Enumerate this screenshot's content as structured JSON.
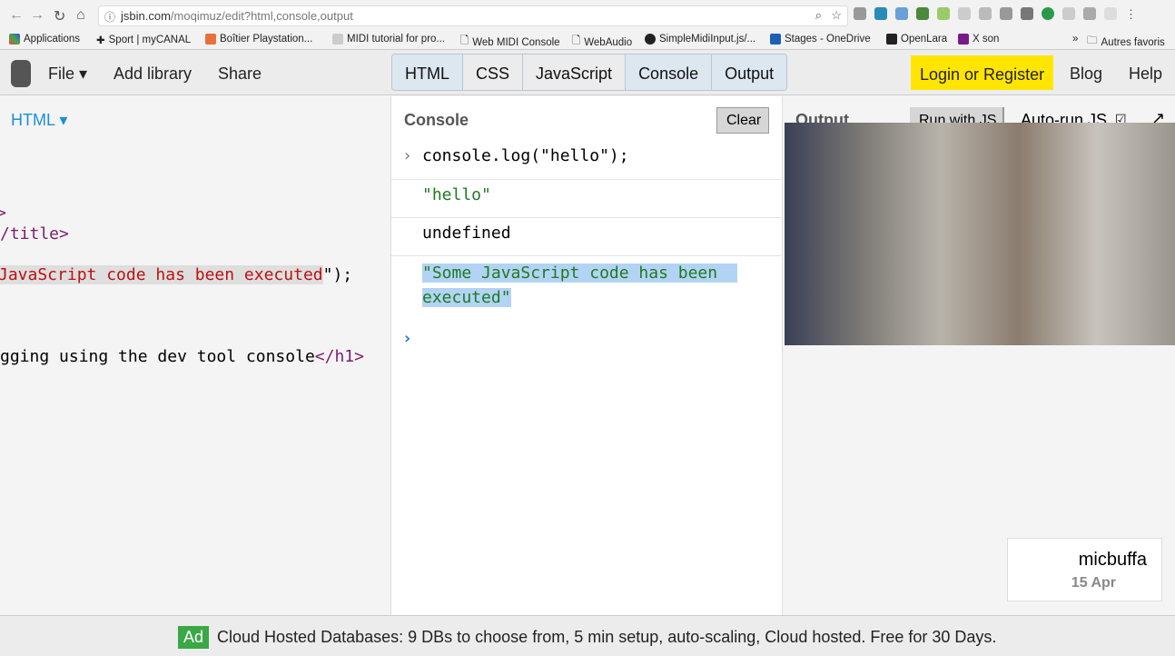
{
  "browser": {
    "url_domain": "jsbin.com",
    "url_path": "/moqimuz/edit?html,console,output",
    "bookmarks": [
      "Applications",
      "Sport | myCANAL",
      "Boîtier Playstation...",
      "MIDI tutorial for pro...",
      "Web MIDI Console",
      "WebAudio",
      "SimpleMidiInput.js/...",
      "Stages - OneDrive",
      "OpenLara",
      "X son"
    ],
    "other_bookmarks": "Autres favoris",
    "overflow": "»"
  },
  "header": {
    "file": "File ▾",
    "add_library": "Add library",
    "share": "Share",
    "tabs": [
      "HTML",
      "CSS",
      "JavaScript",
      "Console",
      "Output"
    ],
    "login": "Login or Register",
    "blog": "Blog",
    "help": "Help"
  },
  "html_panel": {
    "title": "HTML ▾",
    "lines": [
      ">",
      "/title>",
      "JavaScript code has been executed",
      "\");",
      "gging using the dev tool console",
      "</h1>"
    ]
  },
  "console": {
    "title": "Console",
    "clear": "Clear",
    "input": "console.log(\"hello\");",
    "out1": "\"hello\"",
    "out2": "undefined",
    "out3a": "\"Some JavaScript code has been",
    "out3b": "executed\"",
    "prompt": "›"
  },
  "output": {
    "title": "Output",
    "run": "Run with JS",
    "autorun": "Auto-run JS"
  },
  "user_card": {
    "name": "micbuffa",
    "date": "15 Apr"
  },
  "ad": {
    "badge": "Ad",
    "text": "Cloud Hosted Databases: 9 DBs to choose from, 5 min setup, auto-scaling, Cloud hosted. Free for 30 Days."
  }
}
